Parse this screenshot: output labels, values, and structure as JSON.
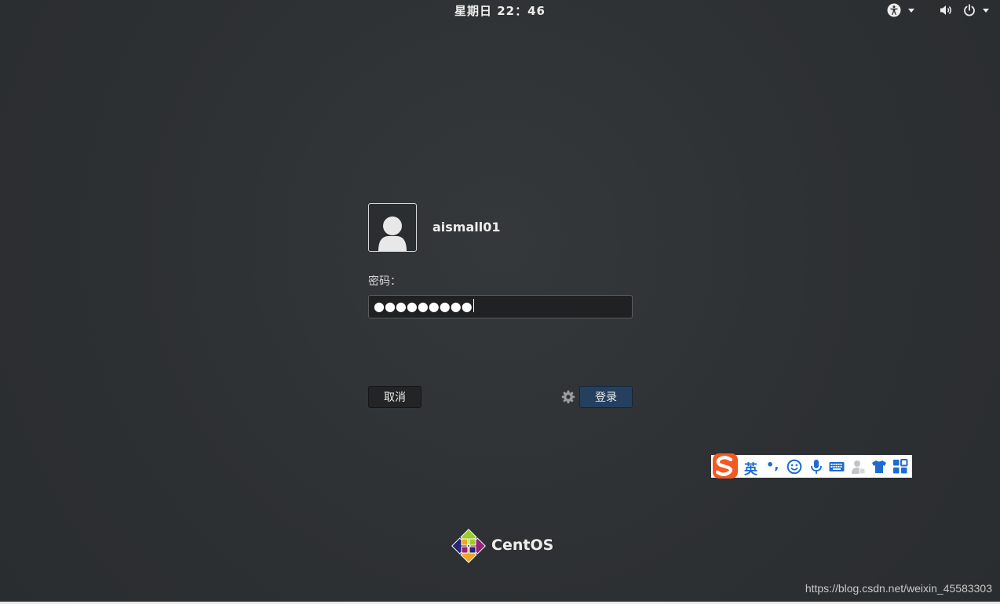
{
  "topbar": {
    "clock": "星期日 22：46",
    "accessibility_icon": "accessibility-icon",
    "volume_icon": "volume-icon",
    "power_icon": "power-icon"
  },
  "login": {
    "username": "aismall01",
    "password_label": "密码：",
    "password_value": "●●●●●●●●●",
    "cancel_label": "取消",
    "login_label": "登录",
    "settings_icon": "gear-icon"
  },
  "ime": {
    "language": "英",
    "punct": "•,",
    "icons": [
      "sogou-logo-icon",
      "emoji-icon",
      "microphone-icon",
      "keyboard-icon",
      "user-icon",
      "shirt-icon",
      "grid-icon"
    ]
  },
  "branding": {
    "os_name": "CentOS"
  },
  "watermark": "https://blog.csdn.net/weixin_45583303",
  "colors": {
    "background": "#2e3133",
    "login_button": "#24405e",
    "ime_blue": "#1d6bd1",
    "sogou_orange": "#f25a23"
  }
}
